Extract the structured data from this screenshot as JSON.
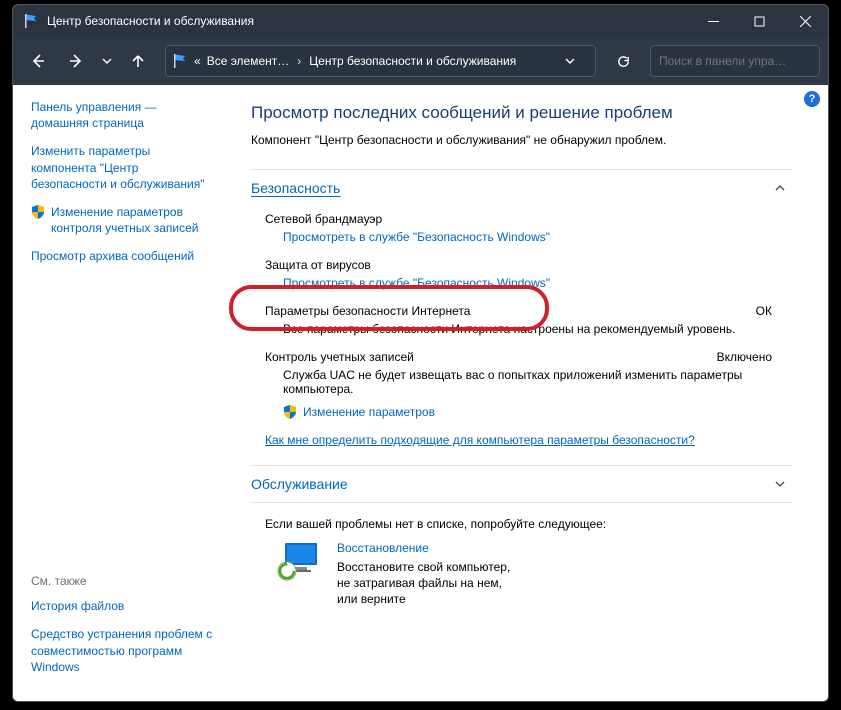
{
  "titlebar": {
    "title": "Центр безопасности и обслуживания"
  },
  "breadcrumb": {
    "crumb1": "Все элемент…",
    "crumb2": "Центр безопасности и обслуживания"
  },
  "search": {
    "placeholder": "Поиск в панели упра…"
  },
  "sidebar": {
    "home": "Панель управления — домашняя страница",
    "changeSettings": "Изменить параметры компонента \"Центр безопасности и обслуживания\"",
    "uac": "Изменение параметров контроля учетных записей",
    "archive": "Просмотр архива сообщений",
    "seeAlsoTitle": "См. также",
    "fileHistory": "История файлов",
    "troubleshoot": "Средство устранения проблем с совместимостью программ Windows"
  },
  "main": {
    "heading": "Просмотр последних сообщений и решение проблем",
    "subtitle": "Компонент \"Центр безопасности и обслуживания\" не обнаружил проблем.",
    "securitySection": "Безопасность",
    "maintenanceSection": "Обслуживание",
    "firewall": {
      "title": "Сетевой брандмауэр",
      "link": "Просмотреть в службе \"Безопасность Windows\""
    },
    "virus": {
      "title": "Защита от вирусов",
      "link": "Просмотреть в службе \"Безопасность Windows\""
    },
    "internet": {
      "title": "Параметры безопасности Интернета",
      "status": "ОК",
      "desc": "Все параметры безопасности Интернета настроены на рекомендуемый уровень."
    },
    "uacItem": {
      "title": "Контроль учетных записей",
      "status": "Включено",
      "desc": "Служба UAC не будет извещать вас о попытках приложений изменить параметры компьютера.",
      "link": "Изменение параметров"
    },
    "faqLink": "Как мне определить подходящие для компьютера параметры безопасности?",
    "troubleIntro": "Если вашей проблемы нет в списке, попробуйте следующее:",
    "recovery": {
      "title": "Восстановление",
      "desc": "Восстановите свой компьютер, не затрагивая файлы на нем, или верните"
    }
  }
}
